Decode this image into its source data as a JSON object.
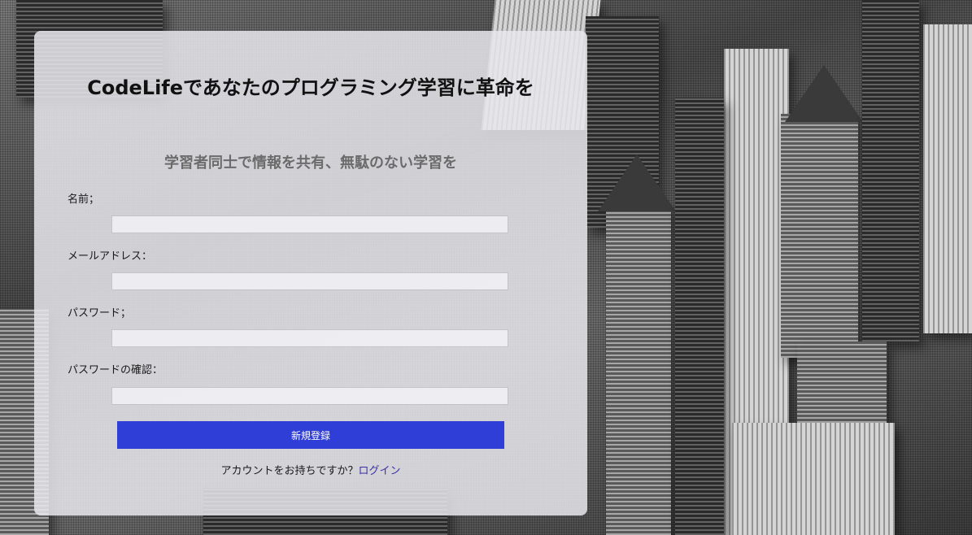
{
  "page": {
    "title": "CodeLifeであなたのプログラミング学習に革命を",
    "subtitle": "学習者同士で情報を共有、無駄のない学習を"
  },
  "form": {
    "name_label": "名前；",
    "name_value": "",
    "email_label": "メールアドレス：",
    "email_value": "",
    "password_label": "パスワード；",
    "password_value": "",
    "password_confirm_label": "パスワードの確認：",
    "password_confirm_value": "",
    "submit_label": "新規登録"
  },
  "footer": {
    "prompt": "アカウントをお持ちですか？",
    "login_link": "ログイン"
  },
  "colors": {
    "accent": "#2e3ed6",
    "link": "#3b2fa8",
    "subtitle": "#6b6b6b"
  }
}
